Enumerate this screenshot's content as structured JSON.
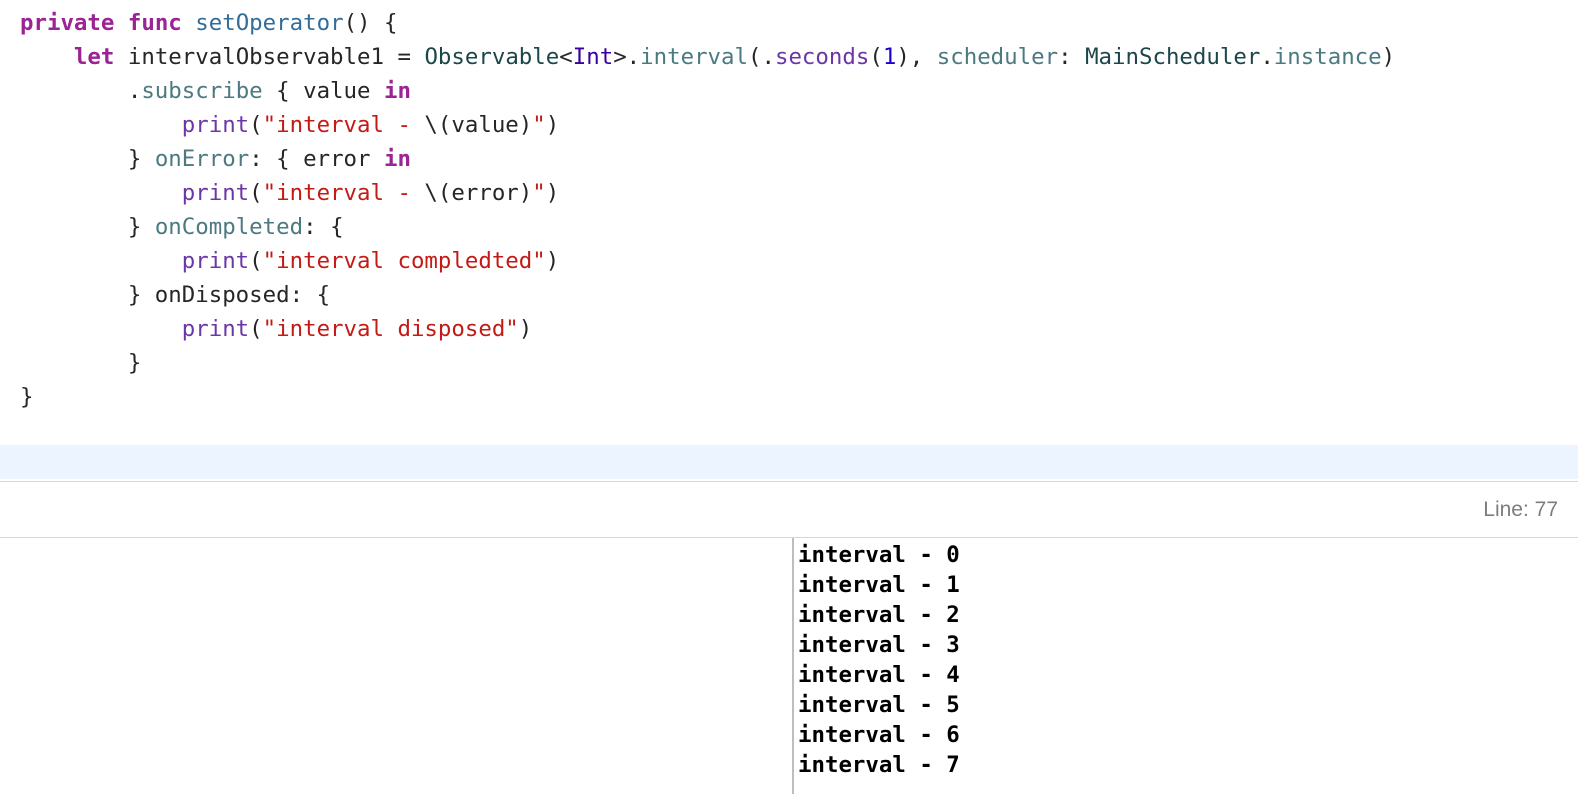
{
  "editor": {
    "code_lines": [
      [
        {
          "t": "private",
          "c": "kw"
        },
        {
          "t": " ",
          "c": "plain"
        },
        {
          "t": "func",
          "c": "kw"
        },
        {
          "t": " ",
          "c": "plain"
        },
        {
          "t": "setOperator",
          "c": "decl"
        },
        {
          "t": "() {",
          "c": "plain"
        }
      ],
      [
        {
          "t": "    ",
          "c": "plain"
        },
        {
          "t": "let",
          "c": "kw"
        },
        {
          "t": " intervalObservable1 = ",
          "c": "plain"
        },
        {
          "t": "Observable",
          "c": "type"
        },
        {
          "t": "<",
          "c": "plain"
        },
        {
          "t": "Int",
          "c": "typeSys"
        },
        {
          "t": ">.",
          "c": "plain"
        },
        {
          "t": "interval",
          "c": "member"
        },
        {
          "t": "(.",
          "c": "plain"
        },
        {
          "t": "seconds",
          "c": "memberSys"
        },
        {
          "t": "(",
          "c": "plain"
        },
        {
          "t": "1",
          "c": "num"
        },
        {
          "t": "), ",
          "c": "plain"
        },
        {
          "t": "scheduler",
          "c": "member"
        },
        {
          "t": ": ",
          "c": "plain"
        },
        {
          "t": "MainScheduler",
          "c": "type"
        },
        {
          "t": ".",
          "c": "plain"
        },
        {
          "t": "instance",
          "c": "member"
        },
        {
          "t": ")",
          "c": "plain"
        }
      ],
      [
        {
          "t": "        .",
          "c": "plain"
        },
        {
          "t": "subscribe",
          "c": "member"
        },
        {
          "t": " { value ",
          "c": "plain"
        },
        {
          "t": "in",
          "c": "kw"
        }
      ],
      [
        {
          "t": "            ",
          "c": "plain"
        },
        {
          "t": "print",
          "c": "func"
        },
        {
          "t": "(",
          "c": "plain"
        },
        {
          "t": "\"interval - ",
          "c": "str"
        },
        {
          "t": "\\(value)",
          "c": "plain"
        },
        {
          "t": "\"",
          "c": "str"
        },
        {
          "t": ")",
          "c": "plain"
        }
      ],
      [
        {
          "t": "        } ",
          "c": "plain"
        },
        {
          "t": "onError",
          "c": "member"
        },
        {
          "t": ": { error ",
          "c": "plain"
        },
        {
          "t": "in",
          "c": "kw"
        }
      ],
      [
        {
          "t": "            ",
          "c": "plain"
        },
        {
          "t": "print",
          "c": "func"
        },
        {
          "t": "(",
          "c": "plain"
        },
        {
          "t": "\"interval - ",
          "c": "str"
        },
        {
          "t": "\\(error)",
          "c": "plain"
        },
        {
          "t": "\"",
          "c": "str"
        },
        {
          "t": ")",
          "c": "plain"
        }
      ],
      [
        {
          "t": "        } ",
          "c": "plain"
        },
        {
          "t": "onCompleted",
          "c": "member"
        },
        {
          "t": ": {",
          "c": "plain"
        }
      ],
      [
        {
          "t": "            ",
          "c": "plain"
        },
        {
          "t": "print",
          "c": "func"
        },
        {
          "t": "(",
          "c": "plain"
        },
        {
          "t": "\"interval compledted\"",
          "c": "str"
        },
        {
          "t": ")",
          "c": "plain"
        }
      ],
      [
        {
          "t": "        } onDisposed: {",
          "c": "plain"
        }
      ],
      [
        {
          "t": "            ",
          "c": "plain"
        },
        {
          "t": "print",
          "c": "func"
        },
        {
          "t": "(",
          "c": "plain"
        },
        {
          "t": "\"interval disposed\"",
          "c": "str"
        },
        {
          "t": ")",
          "c": "plain"
        }
      ],
      [
        {
          "t": "        }",
          "c": "plain"
        }
      ],
      [
        {
          "t": "}",
          "c": "plain"
        }
      ]
    ]
  },
  "status_bar": {
    "line_indicator": "Line: 77"
  },
  "console": {
    "lines": [
      "interval - 0",
      "interval - 1",
      "interval - 2",
      "interval - 3",
      "interval - 4",
      "interval - 5",
      "interval - 6",
      "interval - 7"
    ]
  }
}
